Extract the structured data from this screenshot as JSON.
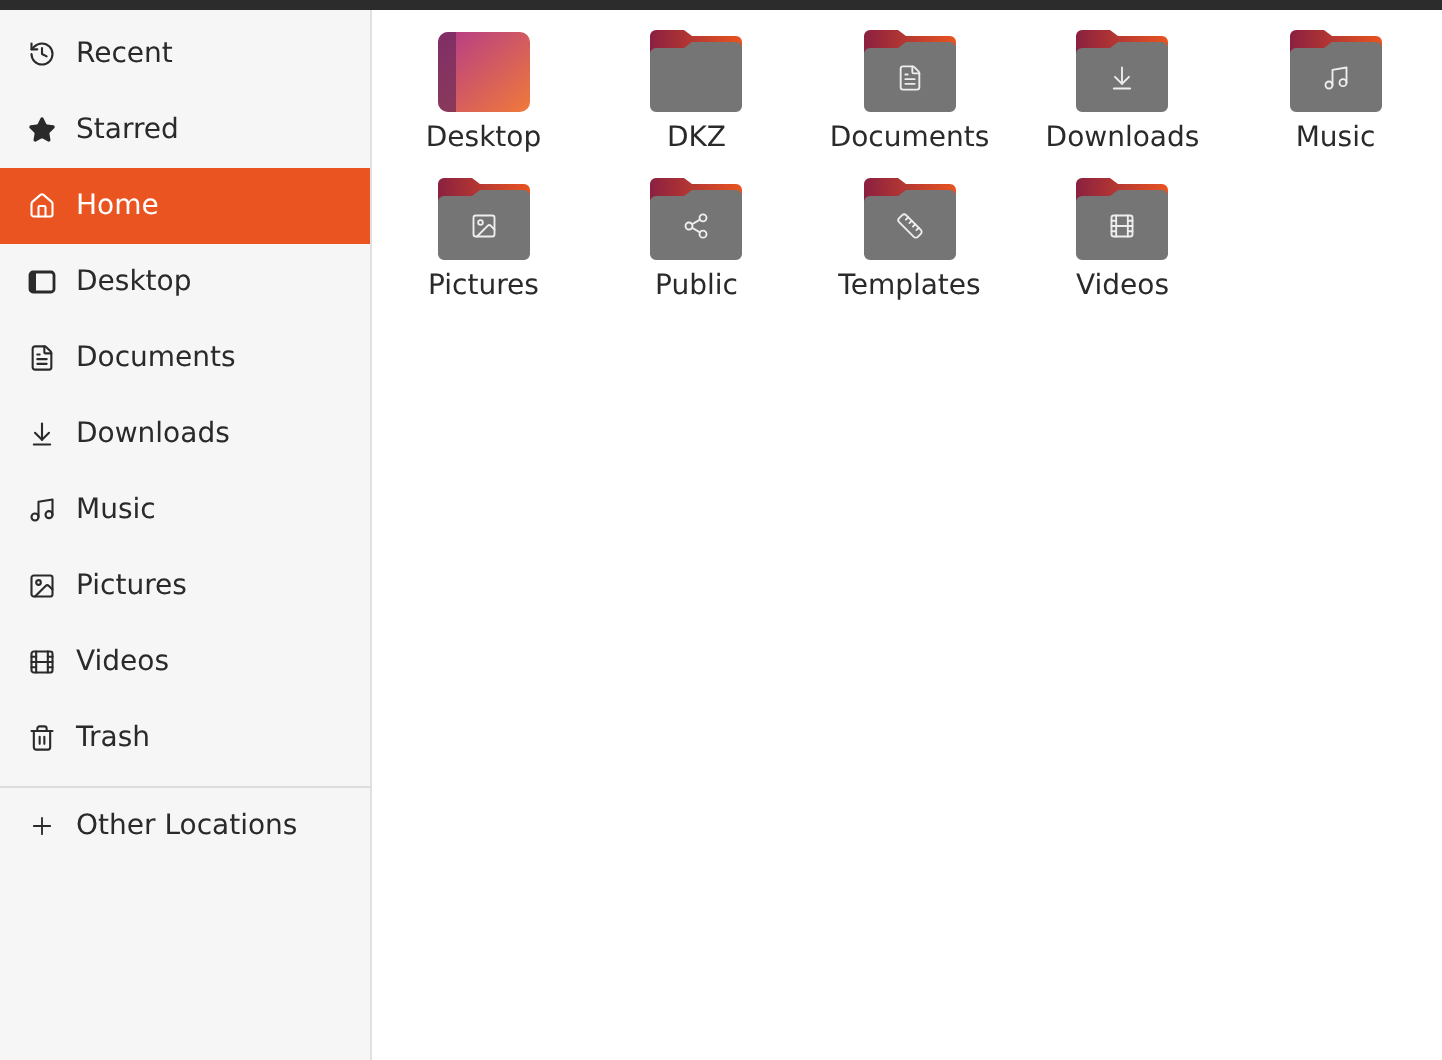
{
  "sidebar": {
    "items": [
      {
        "kind": "recent",
        "label": "Recent",
        "selected": false
      },
      {
        "kind": "starred",
        "label": "Starred",
        "selected": false
      },
      {
        "kind": "home",
        "label": "Home",
        "selected": true
      },
      {
        "kind": "desktop",
        "label": "Desktop",
        "selected": false
      },
      {
        "kind": "documents",
        "label": "Documents",
        "selected": false
      },
      {
        "kind": "downloads",
        "label": "Downloads",
        "selected": false
      },
      {
        "kind": "music",
        "label": "Music",
        "selected": false
      },
      {
        "kind": "pictures",
        "label": "Pictures",
        "selected": false
      },
      {
        "kind": "videos",
        "label": "Videos",
        "selected": false
      },
      {
        "kind": "trash",
        "label": "Trash",
        "selected": false
      }
    ],
    "other_locations": {
      "label": "Other Locations"
    }
  },
  "files": [
    {
      "kind": "desktop",
      "name": "Desktop"
    },
    {
      "kind": "plain",
      "name": "DKZ"
    },
    {
      "kind": "documents",
      "name": "Documents"
    },
    {
      "kind": "downloads",
      "name": "Downloads"
    },
    {
      "kind": "music",
      "name": "Music"
    },
    {
      "kind": "pictures",
      "name": "Pictures"
    },
    {
      "kind": "public",
      "name": "Public"
    },
    {
      "kind": "templates",
      "name": "Templates"
    },
    {
      "kind": "videos",
      "name": "Videos"
    }
  ]
}
